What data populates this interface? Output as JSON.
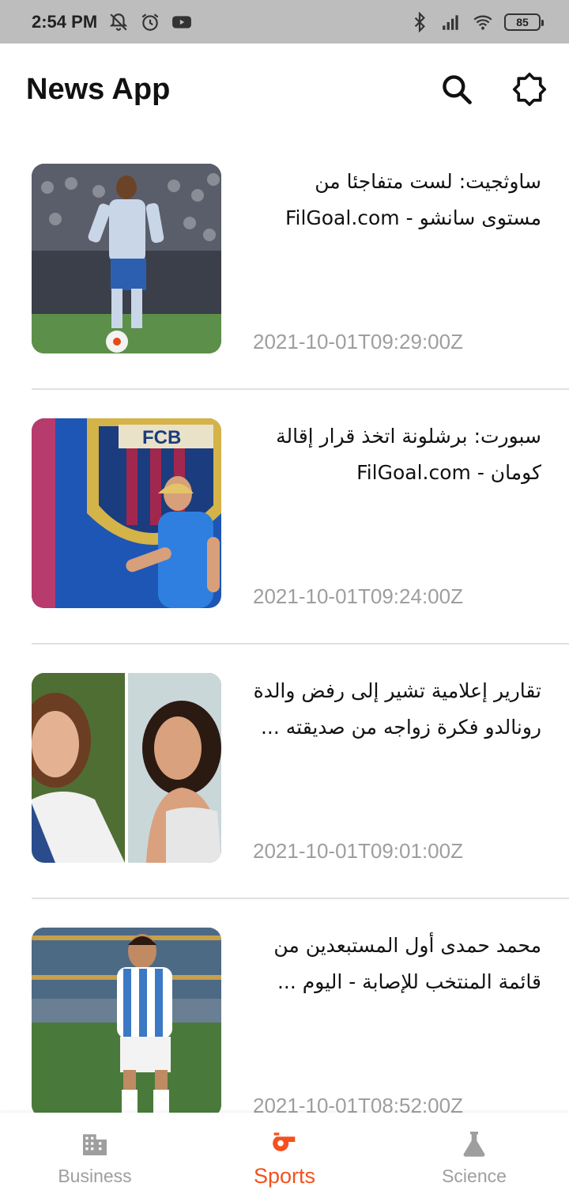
{
  "status_bar": {
    "time": "2:54 PM",
    "battery": "85",
    "icons": [
      "bell-off-icon",
      "alarm-icon",
      "youtube-icon",
      "bluetooth-icon",
      "signal-icon",
      "wifi-icon",
      "battery-icon"
    ]
  },
  "app_bar": {
    "title": "News App",
    "actions": [
      "search-icon",
      "brightness-icon"
    ]
  },
  "articles": [
    {
      "title": "ساوثجيت: لست متفاجئا من مستوى سانشو - FilGoal.com",
      "date": "2021-10-01T09:29:00Z",
      "thumbnail": "football-player-photo"
    },
    {
      "title": "سبورت: برشلونة اتخذ قرار إقالة كومان - FilGoal.com",
      "date": "2021-10-01T09:24:00Z",
      "thumbnail": "coach-fcb-photo"
    },
    {
      "title": "تقارير إعلامية تشير إلى رفض والدة رونالدو فكرة زواجه من صديقته ...",
      "date": "2021-10-01T09:01:00Z",
      "thumbnail": "two-women-photo"
    },
    {
      "title": "محمد حمدى أول المستبعدين من قائمة المنتخب للإصابة - اليوم ...",
      "date": "2021-10-01T08:52:00Z",
      "thumbnail": "striped-player-photo"
    }
  ],
  "bottom_nav": {
    "items": [
      {
        "label": "Business",
        "icon": "building-icon",
        "active": false
      },
      {
        "label": "Sports",
        "icon": "whistle-icon",
        "active": true
      },
      {
        "label": "Science",
        "icon": "flask-icon",
        "active": false
      }
    ]
  },
  "colors": {
    "accent": "#f4511e",
    "status_bar_bg": "#bdbdbd",
    "muted_text": "#9e9e9e",
    "divider": "#e0e0e0"
  }
}
